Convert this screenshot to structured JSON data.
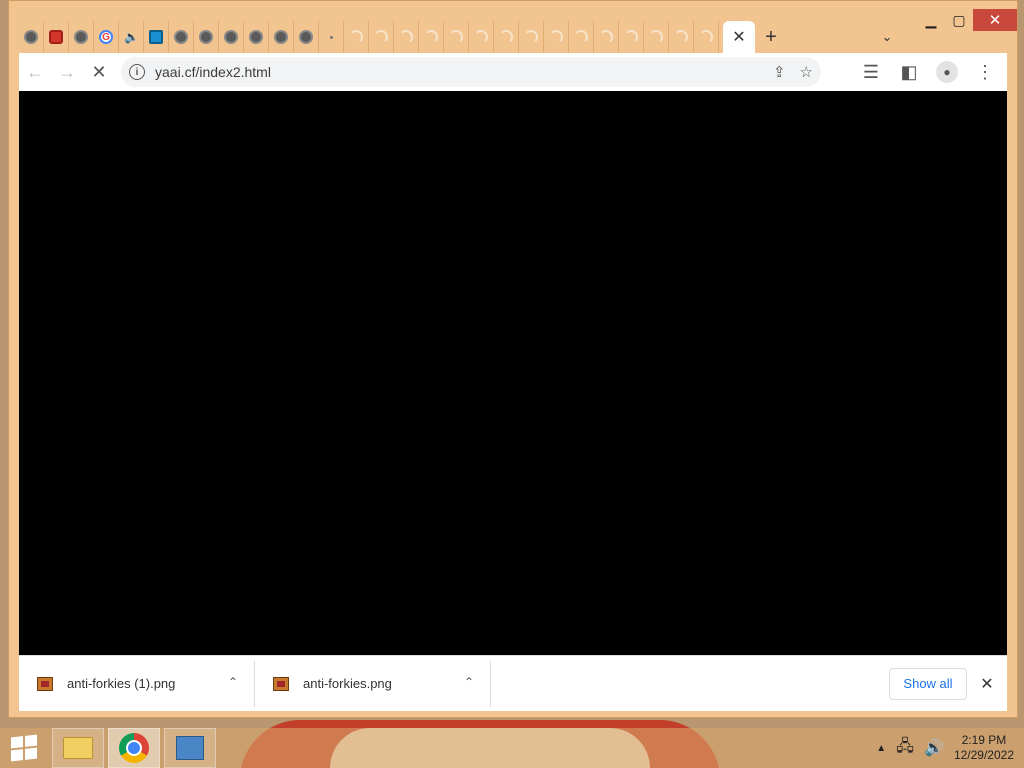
{
  "browser": {
    "url": "yaai.cf/index2.html",
    "tabs_icons": [
      "globe-icon",
      "ticket-icon",
      "globe-icon",
      "google-icon",
      "speaker-icon",
      "location-pin-icon",
      "globe-icon",
      "globe-icon",
      "globe-icon",
      "globe-icon",
      "globe-icon",
      "globe-icon",
      "dot-icon",
      "spinner-icon",
      "spinner-icon",
      "spinner-icon",
      "spinner-icon",
      "spinner-icon",
      "spinner-icon",
      "spinner-icon",
      "spinner-icon",
      "spinner-icon",
      "spinner-icon",
      "spinner-icon",
      "spinner-icon",
      "spinner-icon",
      "spinner-icon",
      "spinner-icon",
      "spinner-icon"
    ],
    "new_tab_symbol": "+",
    "close_tab_symbol": "✕"
  },
  "downloads": {
    "items": [
      {
        "name": "anti-forkies (1).png"
      },
      {
        "name": "anti-forkies.png"
      }
    ],
    "show_all_label": "Show all"
  },
  "taskbar": {
    "time": "2:19 PM",
    "date": "12/29/2022"
  }
}
